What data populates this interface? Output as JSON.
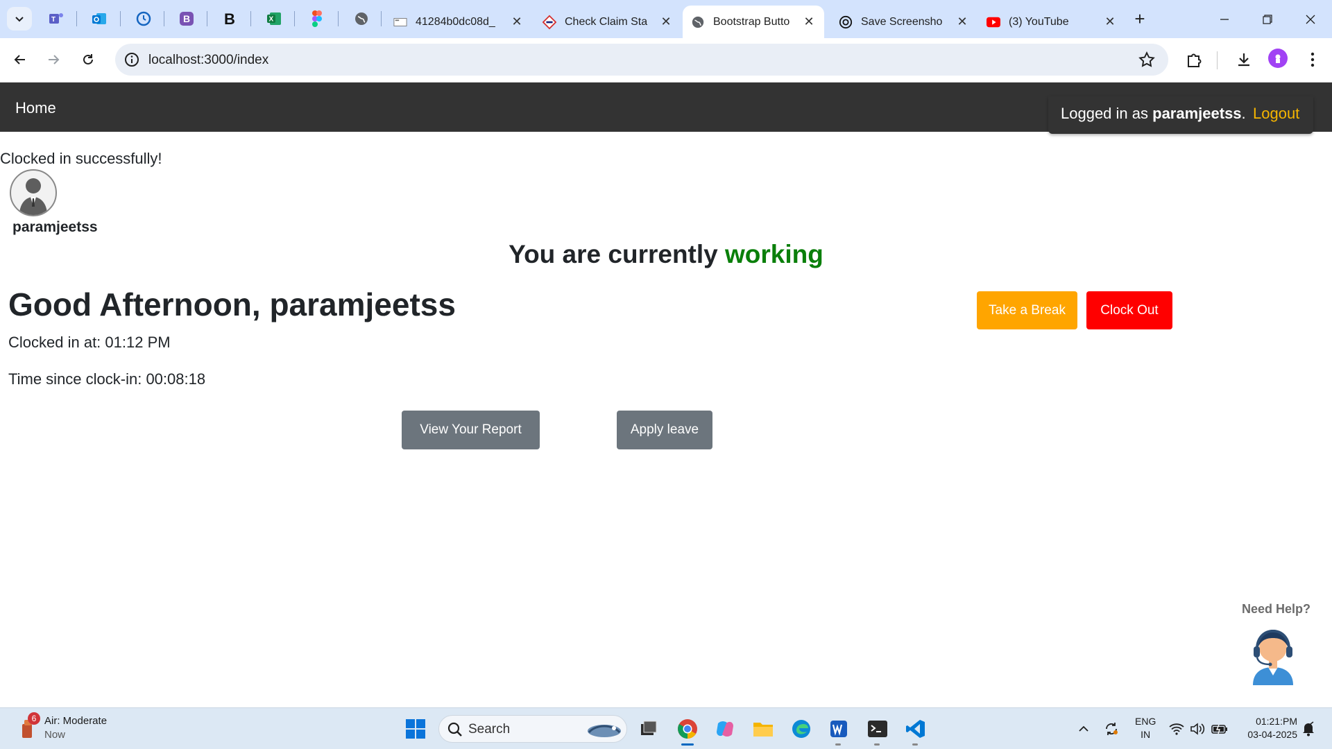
{
  "browser": {
    "tabs": [
      {
        "title": "41284b0dc08d_",
        "favicon": "page-icon"
      },
      {
        "title": "Check Claim Sta",
        "favicon": "claim-icon"
      },
      {
        "title": "Bootstrap Butto",
        "favicon": "globe-icon",
        "active": true
      },
      {
        "title": "Save Screensho",
        "favicon": "chatgpt-icon"
      },
      {
        "title": "(3) YouTube",
        "favicon": "youtube-icon"
      }
    ],
    "url": "localhost:3000/index"
  },
  "app": {
    "nav_home": "Home",
    "logged_in_prefix": "Logged in as",
    "logged_in_user": "paramjeetss",
    "logged_in_suffix": ".",
    "logout": "Logout"
  },
  "page": {
    "flash": "Clocked in successfully!",
    "username": "paramjeetss",
    "status_prefix": "You are currently",
    "status_value": "working",
    "greeting": "Good Afternoon, paramjeetss",
    "clocked_in_at": "Clocked in at: 01:12 PM",
    "time_since": "Time since clock-in: 00:08:18",
    "take_break": "Take a Break",
    "clock_out": "Clock Out",
    "view_report": "View Your Report",
    "apply_leave": "Apply leave",
    "need_help": "Need Help?"
  },
  "colors": {
    "navbar": "#333333",
    "logout": "#f6b500",
    "working": "#0a7f0a",
    "break_button": "#ffa500",
    "clockout_button": "#ff0000",
    "secondary_button": "#6c757d"
  },
  "taskbar": {
    "weather_badge": "6",
    "weather_title": "Air: Moderate",
    "weather_sub": "Now",
    "search_label": "Search",
    "lang_line1": "ENG",
    "lang_line2": "IN",
    "time": "01:21:PM",
    "date": "03-04-2025"
  }
}
